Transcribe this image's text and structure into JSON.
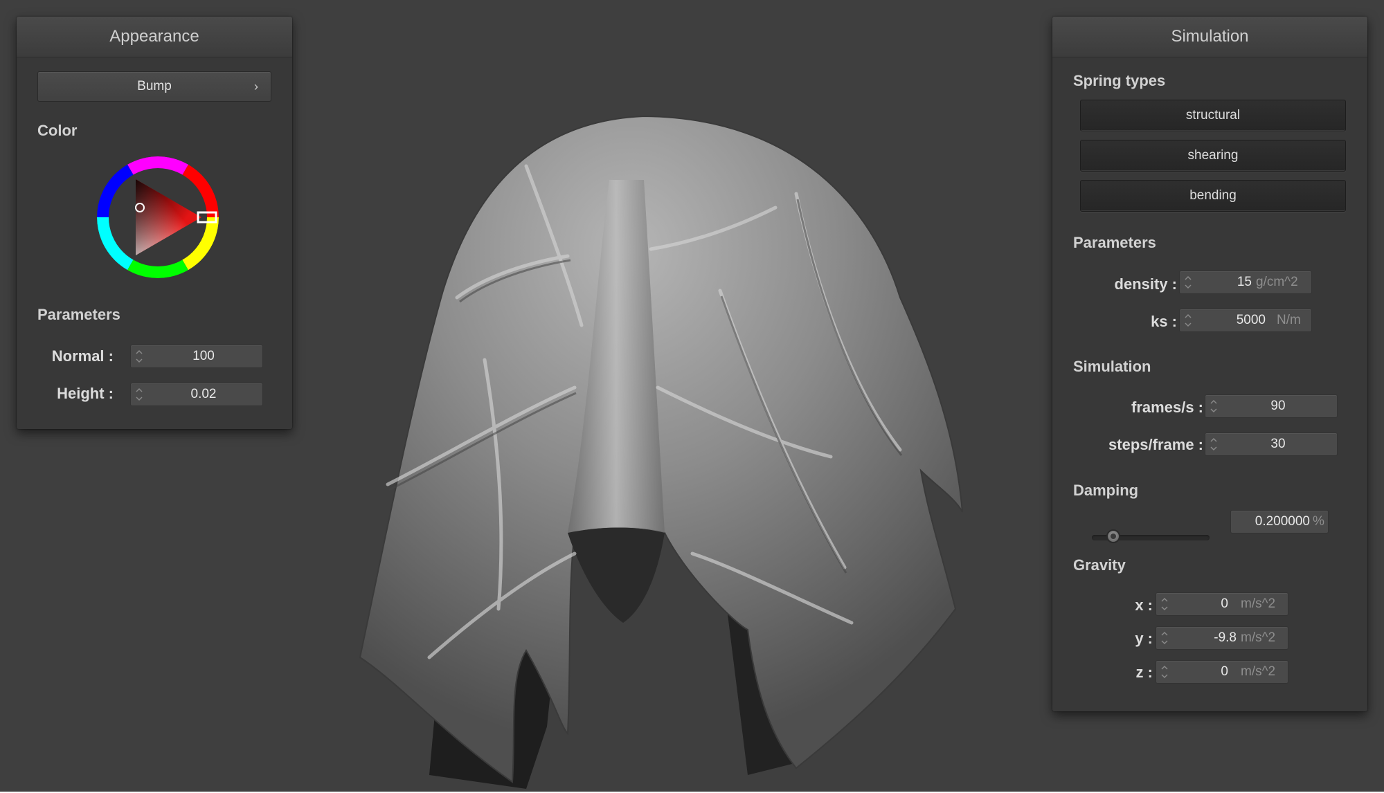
{
  "appearance": {
    "title": "Appearance",
    "mode_dropdown": "Bump",
    "color_label": "Color",
    "params_label": "Parameters",
    "normal_label": "Normal :",
    "normal_value": "100",
    "height_label": "Height :",
    "height_value": "0.02",
    "selected_color": "#e31414"
  },
  "simulation": {
    "title": "Simulation",
    "spring_types_label": "Spring types",
    "spring_buttons": [
      "structural",
      "shearing",
      "bending"
    ],
    "params_label": "Parameters",
    "density_label": "density :",
    "density_value": "15",
    "density_unit": "g/cm^2",
    "ks_label": "ks :",
    "ks_value": "5000",
    "ks_unit": "N/m",
    "sim_label": "Simulation",
    "fps_label": "frames/s :",
    "fps_value": "90",
    "steps_label": "steps/frame :",
    "steps_value": "30",
    "damping_label": "Damping",
    "damping_slider_fraction": 0.18,
    "damping_value": "0.200000",
    "damping_unit": "%",
    "gravity_label": "Gravity",
    "gx_label": "x :",
    "gx_value": "0",
    "gy_label": "y :",
    "gy_value": "-9.8",
    "gz_label": "z :",
    "gz_value": "0",
    "gravity_unit": "m/s^2"
  },
  "scene": {
    "object": "cloth-over-sphere",
    "background_color": "#3f3f3f"
  }
}
